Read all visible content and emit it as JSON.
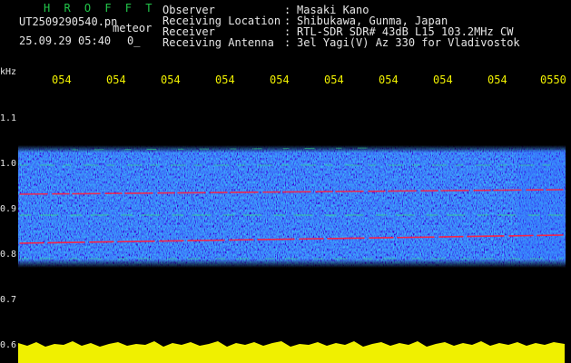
{
  "header": {
    "title": "H R O F F T",
    "filename": "UT2509290540.pn",
    "meteor_label": "meteor",
    "date_time": "25.09.29 05:40",
    "meteor_count": "0_",
    "fields": [
      {
        "label": "Observer",
        "value": "Masaki Kano"
      },
      {
        "label": "Receiving Location",
        "value": "Shibukawa, Gunma, Japan"
      },
      {
        "label": "Receiver",
        "value": "RTL-SDR SDR# 43dB L15 103.2MHz CW"
      },
      {
        "label": "Receiving Antenna",
        "value": "3el Yagi(V) Az 330 for Vladivostok"
      }
    ]
  },
  "axis": {
    "unit": "kHz",
    "freq_ticks": [
      "1.1",
      "1.0",
      "0.9",
      "0.8",
      "0.7",
      "0.6"
    ],
    "time_ticks": [
      "054",
      "054",
      "054",
      "054",
      "054",
      "054",
      "054",
      "054",
      "054",
      "0550"
    ]
  },
  "colors": {
    "background": "#000000",
    "header_green": "#22c64a",
    "header_white": "#e6e6e6",
    "time_yellow": "#f0f000",
    "signal_red": "#ff2040",
    "noise_blue": "#1048ff",
    "amplitude_yellow": "#f0f000"
  }
}
